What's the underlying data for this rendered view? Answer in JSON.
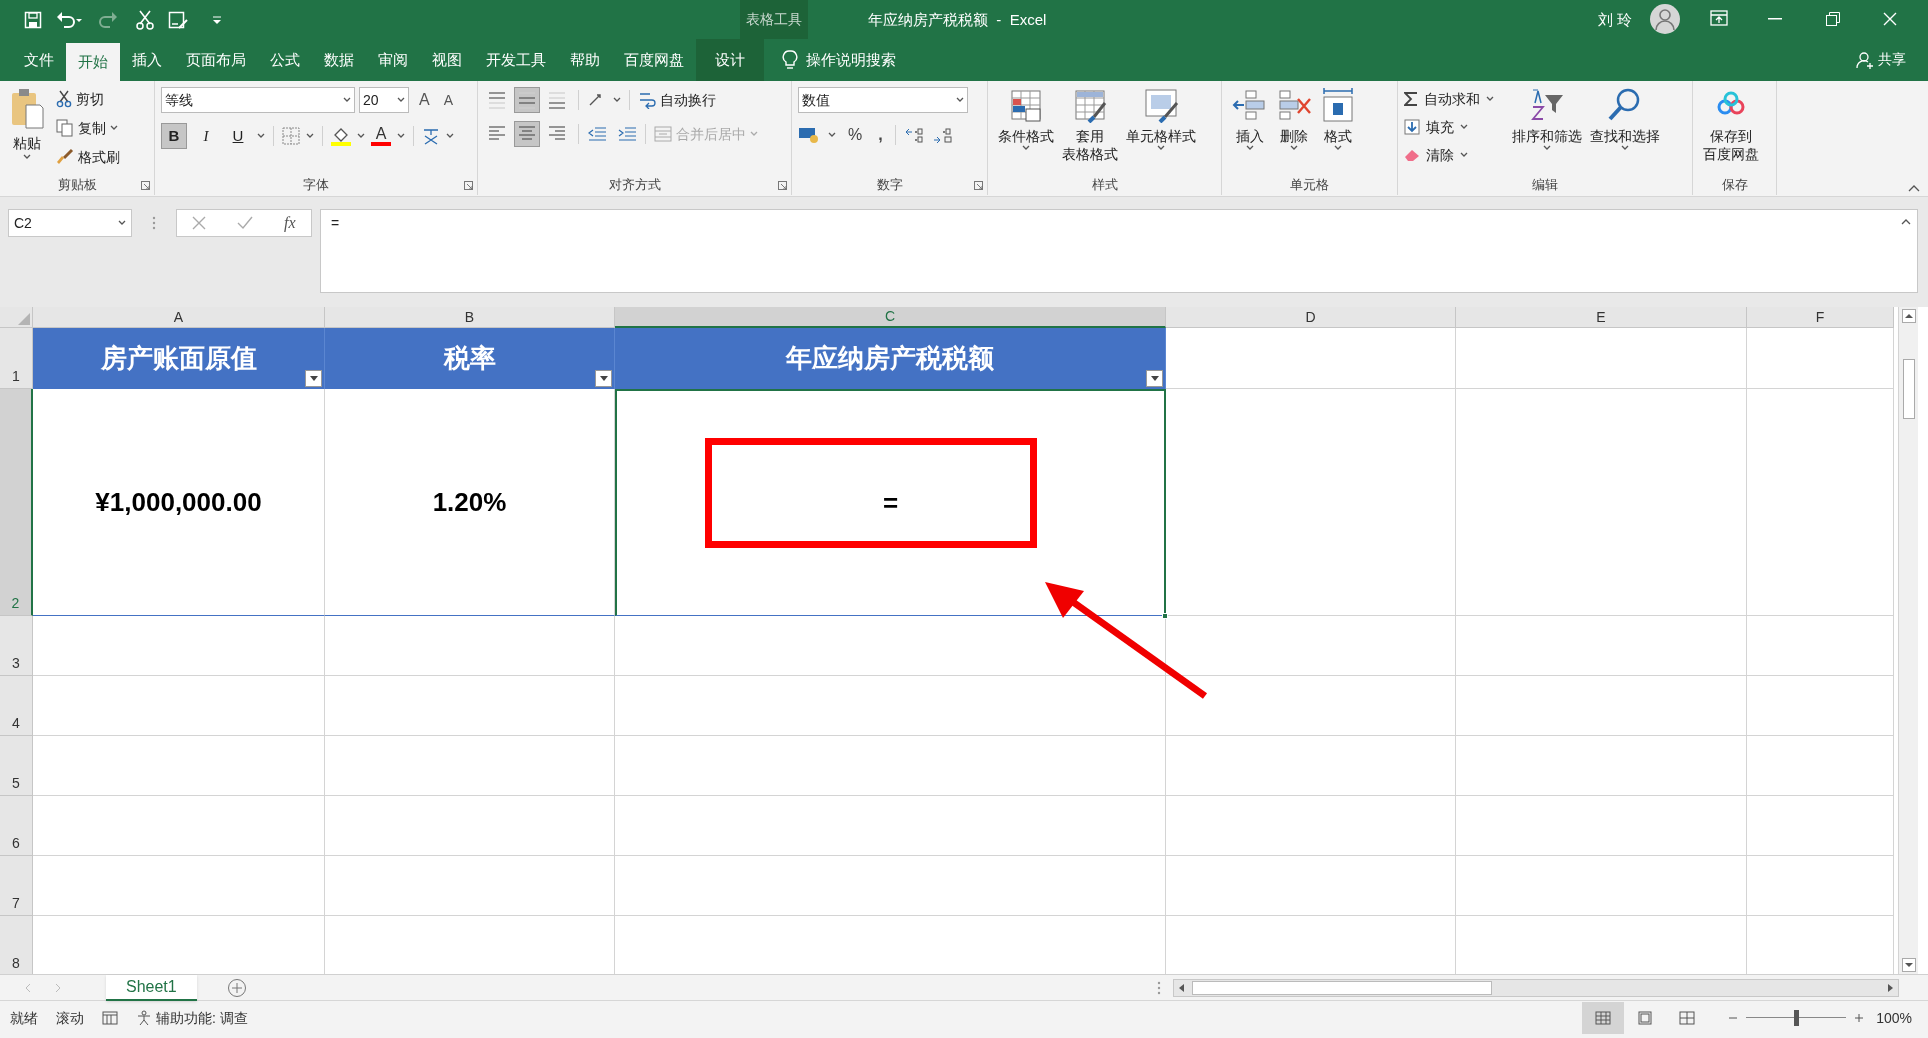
{
  "title_bar": {
    "context_label": "表格工具",
    "title": "年应纳房产税税额  -  Excel",
    "user": "刘 玲"
  },
  "ribbon_tabs": [
    {
      "label": "文件",
      "selected": false,
      "kind": "tab"
    },
    {
      "label": "开始",
      "selected": true,
      "kind": "tab"
    },
    {
      "label": "插入",
      "selected": false,
      "kind": "tab"
    },
    {
      "label": "页面布局",
      "selected": false,
      "kind": "tab"
    },
    {
      "label": "公式",
      "selected": false,
      "kind": "tab"
    },
    {
      "label": "数据",
      "selected": false,
      "kind": "tab"
    },
    {
      "label": "审阅",
      "selected": false,
      "kind": "tab"
    },
    {
      "label": "视图",
      "selected": false,
      "kind": "tab"
    },
    {
      "label": "开发工具",
      "selected": false,
      "kind": "tab"
    },
    {
      "label": "帮助",
      "selected": false,
      "kind": "tab"
    },
    {
      "label": "百度网盘",
      "selected": false,
      "kind": "tab"
    },
    {
      "label": "设计",
      "selected": false,
      "kind": "contextual"
    }
  ],
  "tell_me": "操作说明搜索",
  "share": "共享",
  "clipboard": {
    "label": "剪贴板",
    "paste": "粘贴",
    "cut": "剪切",
    "copy": "复制",
    "format_painter": "格式刷"
  },
  "font": {
    "label": "字体",
    "font_name": "等线",
    "font_size": "20",
    "grow": "A",
    "shrink": "A",
    "styles": [
      {
        "label": "B",
        "selected": true
      },
      {
        "label": "I",
        "selected": false
      },
      {
        "label": "U",
        "selected": false
      }
    ],
    "font_color": "A"
  },
  "alignment": {
    "label": "对齐方式",
    "vertical": [
      {
        "selected": false
      },
      {
        "selected": true
      },
      {
        "selected": false
      }
    ],
    "horizontal": [
      {
        "selected": false
      },
      {
        "selected": true
      },
      {
        "selected": false
      }
    ],
    "wrap_text": "自动换行",
    "merge_center": {
      "label": "合并后居中",
      "disabled": true
    }
  },
  "number": {
    "label": "数字",
    "format": "数值",
    "percent": "%",
    "comma": ","
  },
  "styles": {
    "label": "样式",
    "buttons": [
      [
        "条件格式"
      ],
      [
        "套用",
        "表格格式"
      ],
      [
        "单元格样式"
      ]
    ]
  },
  "cells": {
    "label": "单元格",
    "buttons": [
      "插入",
      "删除",
      "格式"
    ]
  },
  "editing": {
    "label": "编辑",
    "autosum": "自动求和",
    "fill": "填充",
    "clear": "清除",
    "sort_filter": "排序和筛选",
    "find_select": "查找和选择"
  },
  "save": {
    "label": "保存",
    "button": [
      "保存到",
      "百度网盘"
    ]
  },
  "formula_bar": {
    "name_box": "C2",
    "function_label": "fx",
    "formula": "="
  },
  "sheet": {
    "columns": [
      {
        "label": "A",
        "selected": false
      },
      {
        "label": "B",
        "selected": false
      },
      {
        "label": "C",
        "selected": true
      },
      {
        "label": "D",
        "selected": false
      },
      {
        "label": "E",
        "selected": false
      },
      {
        "label": "F",
        "selected": false
      }
    ],
    "rows": [
      {
        "label": "1",
        "selected": false
      },
      {
        "label": "2",
        "selected": true
      },
      {
        "label": "3",
        "selected": false
      },
      {
        "label": "4",
        "selected": false
      },
      {
        "label": "5",
        "selected": false
      },
      {
        "label": "6",
        "selected": false
      },
      {
        "label": "7",
        "selected": false
      },
      {
        "label": "8",
        "selected": false
      }
    ],
    "header": [
      "房产账面原值",
      "税率",
      "年应纳房产税税额"
    ],
    "data": [
      {
        "text": "¥1,000,000.00",
        "active": false
      },
      {
        "text": "1.20%",
        "active": false
      },
      {
        "text": "=",
        "active": true
      }
    ]
  },
  "sheet_tabs": [
    {
      "label": "Sheet1",
      "selected": true
    }
  ],
  "status_bar": {
    "items": [
      "就绪",
      "滚动"
    ],
    "accessibility": "辅助功能: 调查",
    "views": [
      {
        "selected": true
      },
      {
        "selected": false
      },
      {
        "selected": false
      }
    ],
    "zoom": {
      "level": 0.5,
      "reading": "100%"
    }
  }
}
